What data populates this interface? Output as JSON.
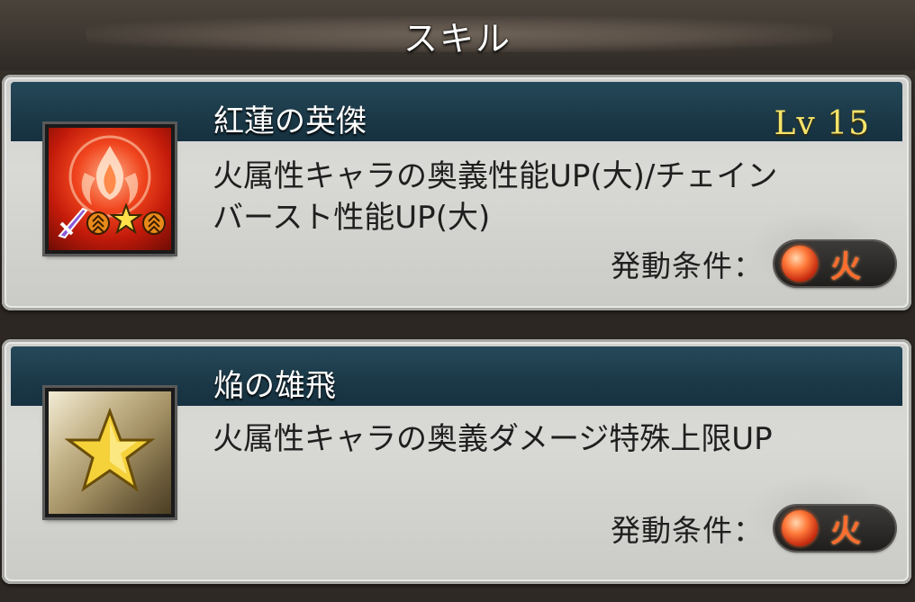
{
  "header": {
    "title": "スキル"
  },
  "skills": [
    {
      "name": "紅蓮の英傑",
      "level": "Lv 15",
      "description_lines": [
        "火属性キャラの奥義性能UP(大)/チェイン",
        "バースト性能UP(大)"
      ],
      "condition_label": "発動条件：",
      "condition_element": "火",
      "icon": "fire-crest-icon",
      "icon_badges": [
        "sword-icon",
        "up-arrow-icon",
        "star-icon",
        "up-arrow-icon"
      ]
    },
    {
      "name": "焔の雄飛",
      "level": "",
      "description_lines": [
        "火属性キャラの奥義ダメージ特殊上限UP"
      ],
      "condition_label": "発動条件：",
      "condition_element": "火",
      "icon": "gold-star-icon"
    }
  ],
  "colors": {
    "header_teal": "#1c3a49",
    "level_yellow": "#f6e46a",
    "fire_orange": "#ff6d2e"
  }
}
